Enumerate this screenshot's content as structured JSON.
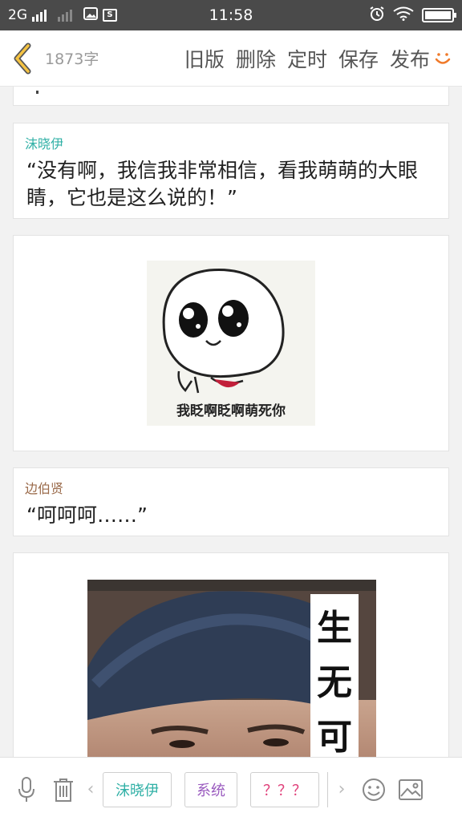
{
  "status_bar": {
    "network": "2G",
    "time": "11:58"
  },
  "toolbar": {
    "word_count": "1873字",
    "old_version": "旧版",
    "delete": "删除",
    "schedule": "定时",
    "save": "保存",
    "publish": "发布"
  },
  "dialogues": [
    {
      "speaker": "沫晓伊",
      "text": "“没有啊，我信我非常相信，看我萌萌的大眼睛，它也是这么说的！”",
      "speaker_color": "#30b0a6"
    },
    {
      "speaker": "边伯贤",
      "text": "“呵呵呵……”",
      "speaker_color": "#9a6a4a"
    }
  ],
  "sticker": {
    "caption": "我眨啊眨啊萌死你"
  },
  "photo": {
    "caption_chars": [
      "生",
      "无",
      "可"
    ]
  },
  "bottom": {
    "chips": [
      {
        "label": "沫晓伊",
        "color": "#30b0a6"
      },
      {
        "label": "系统",
        "color": "#9a5bbf"
      },
      {
        "label": "？？？",
        "color": "#e0407a"
      }
    ]
  },
  "colors": {
    "accent": "#f07a2a",
    "statusbar": "#4a4a4a"
  }
}
